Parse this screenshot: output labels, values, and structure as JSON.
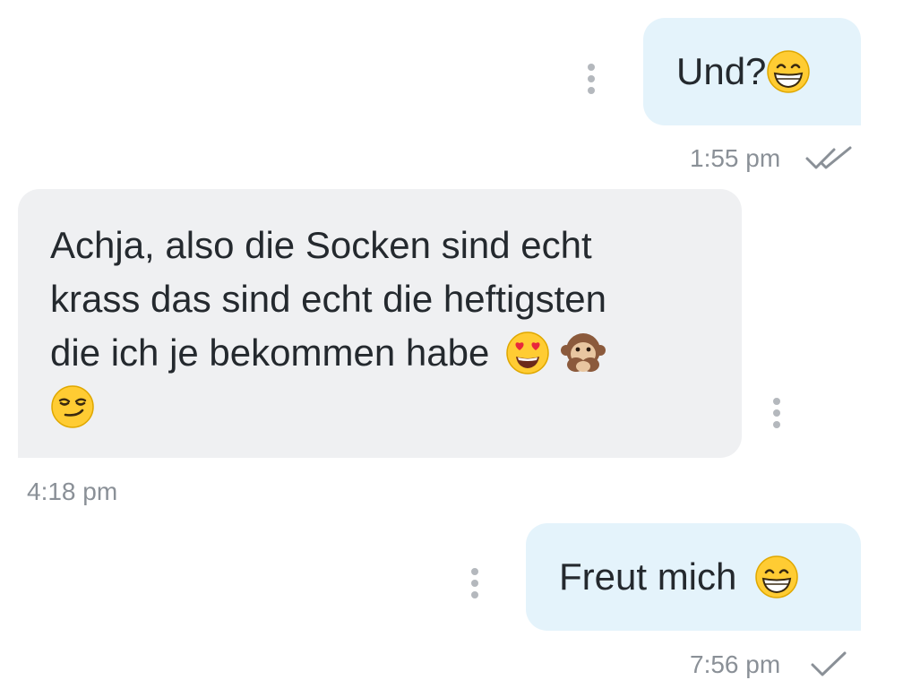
{
  "messages": [
    {
      "direction": "outgoing",
      "text": "Und?",
      "emoji": [
        "grinning-face"
      ],
      "time": "1:55 pm",
      "status": "read"
    },
    {
      "direction": "incoming",
      "lines": [
        "Achja, also die Socken sind echt",
        "krass das sind echt die heftigsten",
        "die ich je bekommen habe"
      ],
      "emoji": [
        "heart-eyes-face",
        "see-no-evil-monkey",
        "smirking-face"
      ],
      "time": "4:18 pm"
    },
    {
      "direction": "outgoing",
      "text": "Freut mich",
      "emoji": [
        "grinning-face"
      ],
      "time": "7:56 pm",
      "status": "sent"
    }
  ],
  "colors": {
    "outgoing_bubble": "#e4f3fb",
    "incoming_bubble": "#eff0f2",
    "text": "#24292e",
    "timestamp": "#8a9097",
    "dots": "#b4b8bd"
  }
}
